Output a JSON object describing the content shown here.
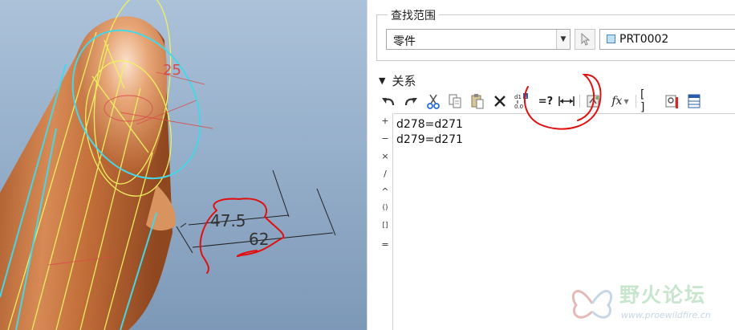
{
  "cad_view": {
    "angle_label": "25",
    "dim_short": "47.5",
    "dim_long": "62"
  },
  "relations_panel": {
    "search_scope": {
      "legend": "查找范围",
      "type_value": "零件",
      "model_value": "PRT0002"
    },
    "section": {
      "label": "关系"
    },
    "toolbar": {
      "icons": [
        "undo-icon",
        "redo-icon",
        "cut-icon",
        "copy-icon",
        "paste-icon",
        "delete-icon",
        "sort-relations-icon",
        "evaluate-icon",
        "dimension-icon",
        "verify-icon",
        "insert-function-icon",
        "brackets-icon",
        "local-parameters-icon",
        "table-icon"
      ]
    },
    "operators": [
      "+",
      "−",
      "×",
      "/",
      "^",
      "()",
      "[]",
      "="
    ],
    "relations": [
      "d278=d271",
      "d279=d271"
    ]
  },
  "watermark": {
    "title": "野火论坛",
    "url": "www.proewildfire.cn"
  },
  "colors": {
    "viewport_bg_top": "#a8bfd6",
    "viewport_bg_bottom": "#7a95b6",
    "part_color": "#c9763f",
    "annotation_red": "#e01010",
    "edge_yellow": "#f0f060",
    "edge_cyan": "#47d6e6"
  }
}
